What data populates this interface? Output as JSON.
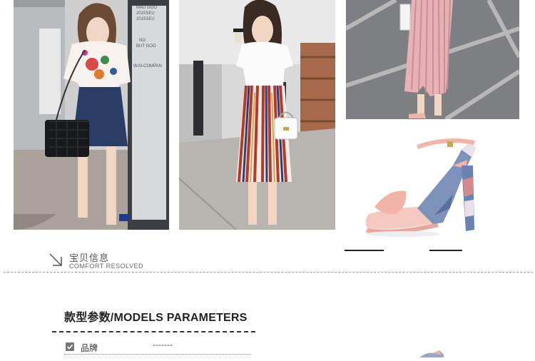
{
  "photos": [
    {
      "name": "model-photo-denim-skirt",
      "storefront_text": [
        "MAD GOO",
        "2015SEU",
        "2015SEU",
        "NO",
        "BUT GOO",
        "W.M-COMPAN"
      ]
    },
    {
      "name": "model-photo-striped-skirt"
    },
    {
      "name": "model-photo-pink-trousers"
    },
    {
      "name": "product-photo-pink-sandal"
    }
  ],
  "section": {
    "title_cn": "宝贝信息",
    "title_en": "COMFORT RESOLVED"
  },
  "params": {
    "title": "款型参数/MODELS PARAMETERS",
    "rows": [
      {
        "label": "品牌",
        "value": "-------"
      }
    ]
  },
  "colors": {
    "accent": "#222222",
    "sandal_pink": "#f2b3a8",
    "skirt_denim": "#2a3d66"
  }
}
